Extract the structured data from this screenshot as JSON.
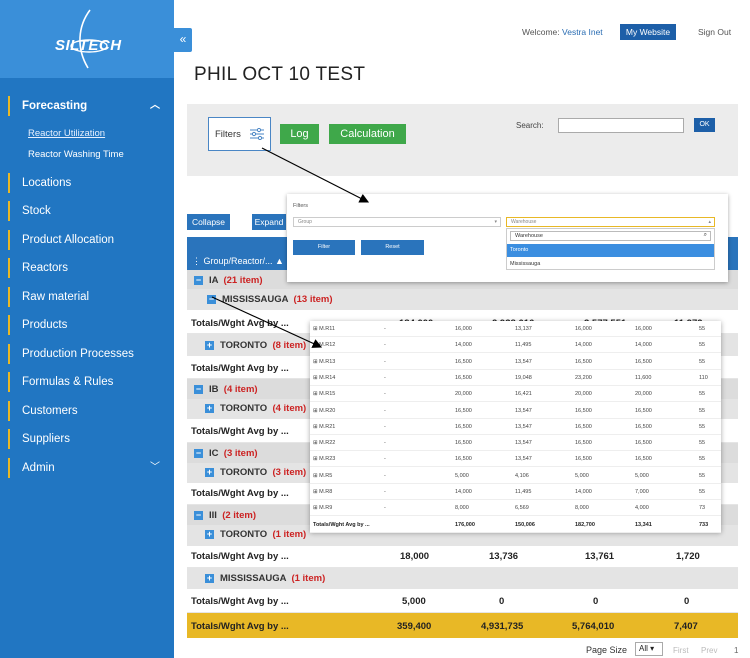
{
  "brand": {
    "logo_text": "SILTECH"
  },
  "header": {
    "welcome_label": "Welcome:",
    "user": "Vestra Inet",
    "my_website": "My Website",
    "sign_out": "Sign Out"
  },
  "page": {
    "title": "PHIL OCT 10 TEST"
  },
  "sidebar": {
    "items": [
      {
        "label": "Forecasting",
        "expanded": true
      },
      {
        "label": "Locations"
      },
      {
        "label": "Stock"
      },
      {
        "label": "Product Allocation"
      },
      {
        "label": "Reactors"
      },
      {
        "label": "Raw material"
      },
      {
        "label": "Products"
      },
      {
        "label": "Production Processes"
      },
      {
        "label": "Formulas & Rules"
      },
      {
        "label": "Customers"
      },
      {
        "label": "Suppliers"
      },
      {
        "label": "Admin"
      }
    ],
    "sub_items": [
      {
        "label": "Reactor Utilization"
      },
      {
        "label": "Reactor Washing Time"
      }
    ]
  },
  "toolbar": {
    "filters": "Filters",
    "log": "Log",
    "calculation": "Calculation",
    "search_label": "Search:",
    "ok": "OK",
    "collapse": "Collapse",
    "expand": "Expand"
  },
  "grid": {
    "header": "Group/Reactor/...",
    "groups": [
      {
        "name": "IA",
        "count": "(21 item)"
      },
      {
        "name": "MISSISSAUGA",
        "count": "(13 item)"
      },
      {
        "name": "TORONTO",
        "count": "(8 item)"
      },
      {
        "name": "IB",
        "count": "(4 item)"
      },
      {
        "name": "TORONTO",
        "count": "(4 item)"
      },
      {
        "name": "IC",
        "count": "(3 item)"
      },
      {
        "name": "TORONTO",
        "count": "(3 item)"
      },
      {
        "name": "III",
        "count": "(2 item)"
      },
      {
        "name": "TORONTO",
        "count": "(1 item)"
      },
      {
        "name": "MISSISSAUGA",
        "count": "(1 item)"
      }
    ],
    "totals_label": "Totals/Wght Avg by ...",
    "totals_partial": [
      "184,000",
      "2,938,616",
      "3,577,551",
      "11,272"
    ],
    "totals_toronto_iii": [
      "18,000",
      "13,736",
      "13,761",
      "1,720"
    ],
    "totals_mississauga_iii": [
      "5,000",
      "0",
      "0",
      "0"
    ],
    "grand_total": [
      "359,400",
      "4,931,735",
      "5,764,010",
      "7,407"
    ]
  },
  "pager": {
    "page_size_label": "Page Size",
    "page_size": "All",
    "first": "First",
    "prev": "Prev",
    "page": "1"
  },
  "filter_popup": {
    "title": "Filters",
    "group_placeholder": "Group",
    "warehouse_placeholder": "Warehouse",
    "filter_btn": "Filter",
    "reset_btn": "Reset",
    "search_value": "Warehouse",
    "options": [
      "Toronto",
      "Mississauga"
    ]
  },
  "detail_popup": {
    "rows": [
      {
        "name": "M.R11",
        "dash": "-",
        "v": [
          "16,000",
          "13,137",
          "16,000",
          "16,000",
          "55"
        ]
      },
      {
        "name": "M.R12",
        "dash": "-",
        "v": [
          "14,000",
          "11,495",
          "14,000",
          "14,000",
          "55"
        ]
      },
      {
        "name": "M.R13",
        "dash": "-",
        "v": [
          "16,500",
          "13,547",
          "16,500",
          "16,500",
          "55"
        ]
      },
      {
        "name": "M.R14",
        "dash": "-",
        "v": [
          "16,500",
          "19,048",
          "23,200",
          "11,600",
          "110"
        ]
      },
      {
        "name": "M.R15",
        "dash": "-",
        "v": [
          "20,000",
          "16,421",
          "20,000",
          "20,000",
          "55"
        ]
      },
      {
        "name": "M.R20",
        "dash": "-",
        "v": [
          "16,500",
          "13,547",
          "16,500",
          "16,500",
          "55"
        ]
      },
      {
        "name": "M.R21",
        "dash": "-",
        "v": [
          "16,500",
          "13,547",
          "16,500",
          "16,500",
          "55"
        ]
      },
      {
        "name": "M.R22",
        "dash": "-",
        "v": [
          "16,500",
          "13,547",
          "16,500",
          "16,500",
          "55"
        ]
      },
      {
        "name": "M.R23",
        "dash": "-",
        "v": [
          "16,500",
          "13,547",
          "16,500",
          "16,500",
          "55"
        ]
      },
      {
        "name": "M.R5",
        "dash": "-",
        "v": [
          "5,000",
          "4,106",
          "5,000",
          "5,000",
          "55"
        ]
      },
      {
        "name": "M.R8",
        "dash": "-",
        "v": [
          "14,000",
          "11,495",
          "14,000",
          "7,000",
          "55"
        ]
      },
      {
        "name": "M.R9",
        "dash": "-",
        "v": [
          "8,000",
          "6,569",
          "8,000",
          "4,000",
          "73"
        ]
      }
    ],
    "total_label": "Totals/Wght Avg by ...",
    "total": [
      "176,000",
      "150,006",
      "182,700",
      "13,341",
      "733"
    ]
  }
}
